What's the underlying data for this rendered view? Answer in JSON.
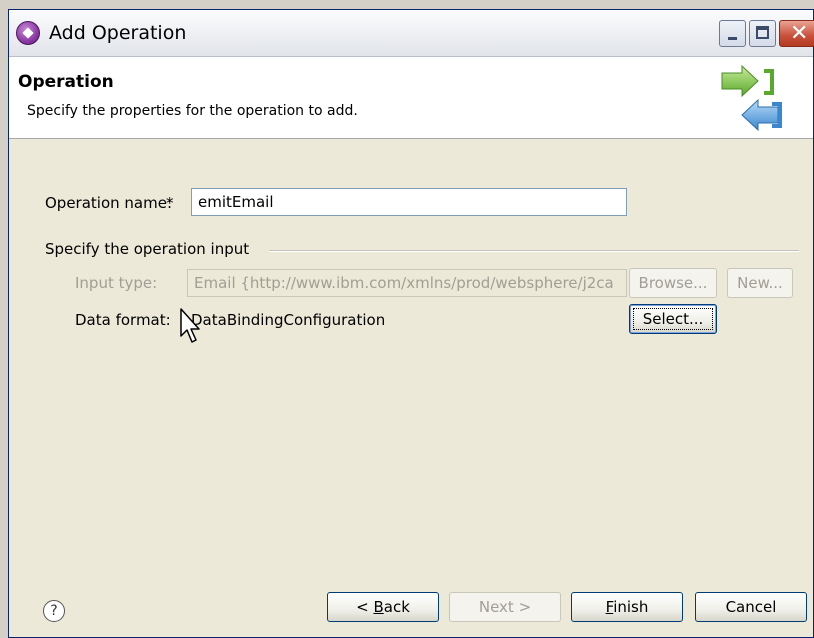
{
  "window": {
    "title": "Add Operation"
  },
  "banner": {
    "title": "Operation",
    "description": "Specify the properties for the operation to add."
  },
  "form": {
    "operation_name_label": "Operation name:",
    "required_marker": "*",
    "operation_name_value": "emitEmail",
    "group_label": "Specify the operation input",
    "input_type_label": "Input type:",
    "input_type_value": "Email  {http://www.ibm.com/xmlns/prod/websphere/j2ca",
    "browse_label": "Browse...",
    "new_label": "New...",
    "data_format_label": "Data format:",
    "data_format_value": "DataBindingConfiguration",
    "select_label": "Select..."
  },
  "footer": {
    "back_prefix": "< ",
    "back_mnemonic": "B",
    "back_rest": "ack",
    "next_label": "Next >",
    "finish_mnemonic": "F",
    "finish_rest": "inish",
    "cancel_label": "Cancel"
  },
  "colors": {
    "banner_bg": "#ffffff",
    "dialog_bg": "#ece9d8",
    "disabled_text": "#a19e93"
  },
  "icons": [
    "app-icon",
    "wizard-banner-icon",
    "help-icon",
    "mouse-cursor-icon"
  ]
}
